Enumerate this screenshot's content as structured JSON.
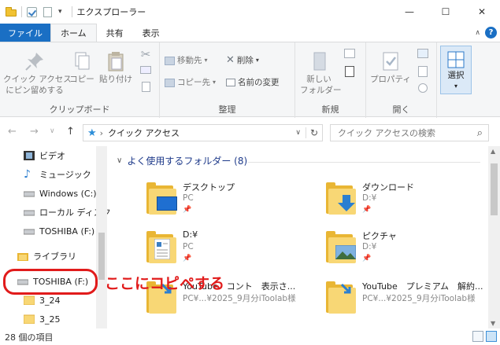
{
  "window": {
    "title": "エクスプローラー",
    "minimize": "—",
    "maximize": "☐",
    "close": "✕"
  },
  "tabs": [
    "ファイル",
    "ホーム",
    "共有",
    "表示"
  ],
  "ribbon": {
    "pin_label": "クイック アクセス\nにピン留めする",
    "copy": "コピー",
    "paste": "貼り付け",
    "clipboard_group": "クリップボード",
    "move_to": "移動先",
    "copy_to": "コピー先",
    "delete": "削除",
    "rename": "名前の変更",
    "organize_group": "整理",
    "new_folder": "新しい\nフォルダー",
    "new_group": "新規",
    "properties": "プロパティ",
    "open_group": "開く",
    "select": "選択"
  },
  "address": {
    "path": "クイック アクセス",
    "search_placeholder": "クイック アクセスの検索"
  },
  "nav_items": [
    {
      "label": "ビデオ",
      "icon": "video-icon"
    },
    {
      "label": "ミュージック",
      "icon": "music-icon"
    },
    {
      "label": "Windows (C:)",
      "icon": "drive-icon"
    },
    {
      "label": "ローカル ディスク",
      "icon": "drive-icon"
    },
    {
      "label": "TOSHIBA (F:)",
      "icon": "usb-drive-icon"
    },
    {
      "label": "ライブラリ",
      "icon": "library-icon"
    },
    {
      "label": "TOSHIBA (F:)",
      "icon": "usb-drive-icon"
    },
    {
      "label": "3_24",
      "icon": "folder-icon"
    },
    {
      "label": "3_25",
      "icon": "folder-icon"
    }
  ],
  "content": {
    "group_header": "よく使用するフォルダー (8)",
    "tiles": [
      {
        "name": "デスクトップ",
        "sub": "PC"
      },
      {
        "name": "ダウンロード",
        "sub": "D:¥"
      },
      {
        "name": "D:¥",
        "sub": "PC"
      },
      {
        "name": "ピクチャ",
        "sub": "D:¥"
      },
      {
        "name": "YouTube　コント　表示さ...",
        "sub": "PC¥...¥2025_9月分iToolab様"
      },
      {
        "name": "YouTube　プレミアム　解約...",
        "sub": "PC¥...¥2025_9月分iToolab様"
      }
    ]
  },
  "status": {
    "count": "28 個の項目"
  },
  "annotation": {
    "text": "ここにコピペする"
  }
}
